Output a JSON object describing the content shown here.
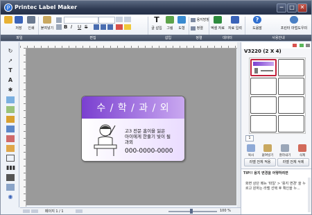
{
  "app": {
    "title": "Printec Label Maker"
  },
  "window_buttons": [
    "─",
    "□",
    "✕"
  ],
  "ribbon": {
    "buttons": [
      {
        "label": "열기",
        "icon": "open-folder-icon"
      },
      {
        "label": "저장",
        "icon": "save-disk-icon"
      },
      {
        "label": "인쇄",
        "icon": "printer-icon"
      },
      {
        "label": "붙여넣기",
        "icon": "paste-icon"
      },
      {
        "label": "글 삽입",
        "icon": "text-insert-icon"
      },
      {
        "label": "그림",
        "icon": "picture-icon"
      },
      {
        "label": "도형",
        "icon": "shape-icon"
      },
      {
        "label": "용지방향",
        "icon": "paper-orientation-icon"
      },
      {
        "label": "정렬",
        "icon": "align-icon"
      },
      {
        "label": "엑셀 자료",
        "icon": "excel-icon"
      },
      {
        "label": "자료 입력",
        "icon": "data-input-icon"
      },
      {
        "label": "도움말",
        "icon": "help-icon"
      },
      {
        "label": "프린터 마법도우미",
        "icon": "printer-wizard-icon"
      }
    ],
    "groups": [
      "파일",
      "편집",
      "삽입",
      "정렬",
      "데이터",
      "사용안내"
    ]
  },
  "label": {
    "title": "수 / 학 / 과 / 외",
    "line1": "고3 전문 홈이을 잃은",
    "line2": "아이에게 한줄기 빛이 될",
    "line3": "과외",
    "phone": "000-0000-0000"
  },
  "status": {
    "page": "페이지 1 / 1",
    "zoom": "100 %"
  },
  "right_panel": {
    "layout_title": "V3220 (2 X 4)",
    "page_number": "1",
    "buttons": [
      "복사",
      "붙여넣기",
      "잘라내기",
      "삭제"
    ],
    "apply_all": "라벨 전체 적용",
    "delete_all": "라벨 전체 삭제",
    "tips_title": "TIP!! 용지 변경을 어떻하려면",
    "tips_text": "화면 상단 메뉴 '파일' > '용지 변경' 을 누르고 원하는 라벨 선택 후 확인을 누..."
  },
  "colors": {
    "titlebar": "#2e3a52",
    "label_gradient_start": "#7a3fd0",
    "label_gradient_end": "#c9a8f0",
    "selected_cell": "#c0203a"
  }
}
